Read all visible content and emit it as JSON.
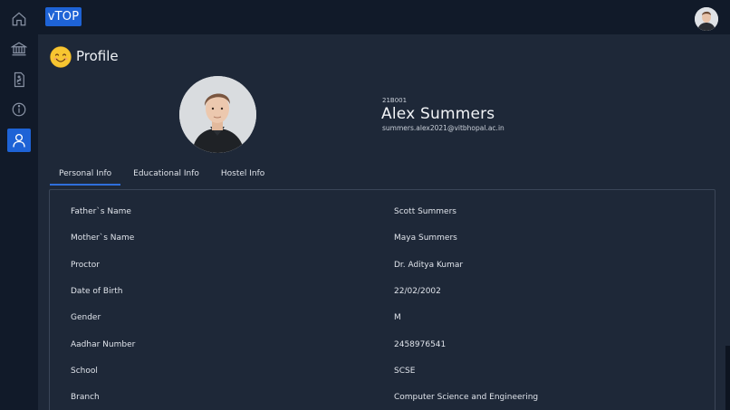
{
  "app": {
    "logo_text": "vTOP"
  },
  "sidebar": {
    "items": [
      {
        "name": "home",
        "icon": "home-icon"
      },
      {
        "name": "institution",
        "icon": "bank-icon"
      },
      {
        "name": "documents",
        "icon": "document-icon"
      },
      {
        "name": "info",
        "icon": "info-icon"
      },
      {
        "name": "profile",
        "icon": "user-icon",
        "active": true
      }
    ],
    "active_color": "#1e63d6"
  },
  "header": {
    "emoji_icon": "smiling-face-icon",
    "title": "Profile"
  },
  "profile": {
    "registration_number": "21B001",
    "name": "Alex Summers",
    "email": "summers.alex2021@vitbhopal.ac.in"
  },
  "tabs": [
    {
      "label": "Personal Info",
      "active": true
    },
    {
      "label": "Educational Info",
      "active": false
    },
    {
      "label": "Hostel Info",
      "active": false
    }
  ],
  "personal_info": {
    "rows": [
      {
        "label": "Father`s Name",
        "value": "Scott Summers"
      },
      {
        "label": "Mother`s Name",
        "value": "Maya Summers"
      },
      {
        "label": "Proctor",
        "value": "Dr. Aditya Kumar"
      },
      {
        "label": "Date of Birth",
        "value": "22/02/2002"
      },
      {
        "label": "Gender",
        "value": "M"
      },
      {
        "label": "Aadhar Number",
        "value": "2458976541"
      },
      {
        "label": "School",
        "value": "SCSE"
      },
      {
        "label": "Branch",
        "value": "Computer Science and Engineering"
      }
    ]
  },
  "colors": {
    "background": "#1e2838",
    "chrome": "#111a29",
    "accent": "#1e63d6"
  }
}
